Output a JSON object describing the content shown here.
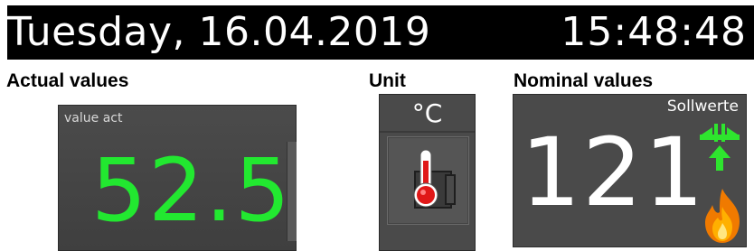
{
  "header": {
    "date": "Tuesday, 16.04.2019",
    "time": "15:48:48"
  },
  "sections": {
    "actual_title": "Actual values",
    "unit_title": "Unit",
    "nominal_title": "Nominal values"
  },
  "actual_tile": {
    "label": "value act",
    "value": "52.5",
    "value_color": "#22e830"
  },
  "unit_tile": {
    "unit": "°C",
    "icon": "thermometer-heater-icon"
  },
  "nominal_tile": {
    "label": "Sollwerte",
    "value": "121",
    "icons": [
      "setpoint-arrows-icon",
      "flame-icon"
    ],
    "arrow_color": "#2ee52e"
  }
}
